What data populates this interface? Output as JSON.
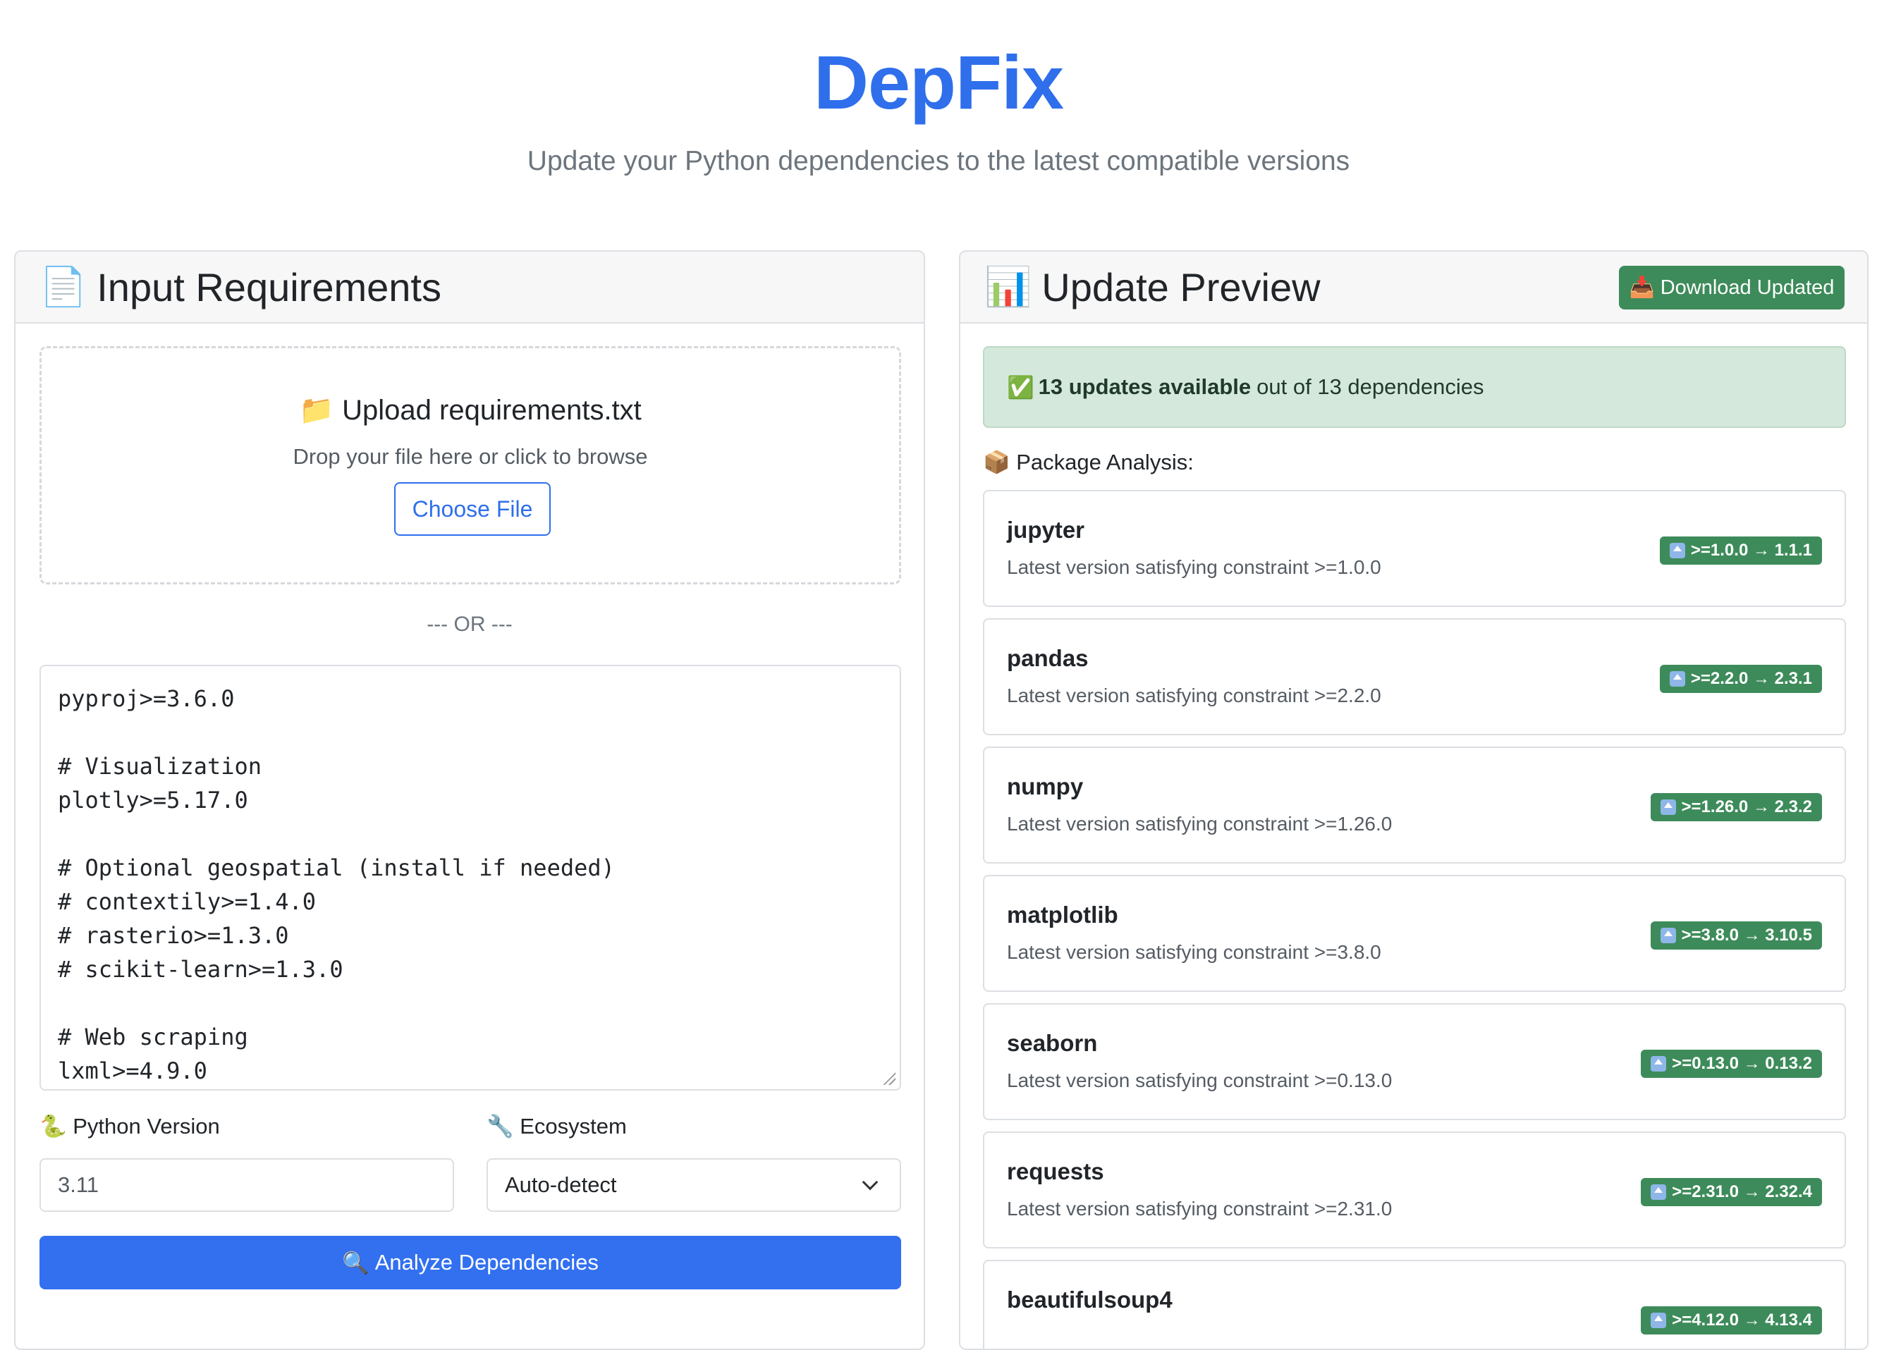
{
  "header": {
    "title": "DepFix",
    "subtitle": "Update your Python dependencies to the latest compatible versions"
  },
  "input_panel": {
    "icon": "📄",
    "title": "Input Requirements",
    "upload": {
      "icon": "📁",
      "title": "Upload requirements.txt",
      "hint": "Drop your file here or click to browse",
      "button": "Choose File"
    },
    "or_text": "--- OR ---",
    "textarea_value": "pyproj>=3.6.0\n\n# Visualization\nplotly>=5.17.0\n\n# Optional geospatial (install if needed)\n# contextily>=1.4.0\n# rasterio>=1.3.0\n# scikit-learn>=1.3.0\n\n# Web scraping\nlxml>=4.9.0",
    "python_version": {
      "icon": "🐍",
      "label": "Python Version",
      "value": "3.11"
    },
    "ecosystem": {
      "icon": "🔧",
      "label": "Ecosystem",
      "value": "Auto-detect"
    },
    "analyze_button": {
      "icon": "🔍",
      "label": "Analyze Dependencies"
    }
  },
  "preview_panel": {
    "icon": "📊",
    "title": "Update Preview",
    "download_button": {
      "icon": "📥",
      "label": "Download Updated"
    },
    "summary": {
      "icon": "✅",
      "bold": "13 updates available",
      "rest": "out of 13 dependencies"
    },
    "section_label": {
      "icon": "📦",
      "text": "Package Analysis:"
    },
    "packages": [
      {
        "name": "jupyter",
        "desc": "Latest version satisfying constraint >=1.0.0",
        "badge": ">=1.0.0 → 1.1.1"
      },
      {
        "name": "pandas",
        "desc": "Latest version satisfying constraint >=2.2.0",
        "badge": ">=2.2.0 → 2.3.1"
      },
      {
        "name": "numpy",
        "desc": "Latest version satisfying constraint >=1.26.0",
        "badge": ">=1.26.0 → 2.3.2"
      },
      {
        "name": "matplotlib",
        "desc": "Latest version satisfying constraint >=3.8.0",
        "badge": ">=3.8.0 → 3.10.5"
      },
      {
        "name": "seaborn",
        "desc": "Latest version satisfying constraint >=0.13.0",
        "badge": ">=0.13.0 → 0.13.2"
      },
      {
        "name": "requests",
        "desc": "Latest version satisfying constraint >=2.31.0",
        "badge": ">=2.31.0 → 2.32.4"
      },
      {
        "name": "beautifulsoup4",
        "desc": "",
        "badge": ">=4.12.0 → 4.13.4"
      }
    ]
  }
}
